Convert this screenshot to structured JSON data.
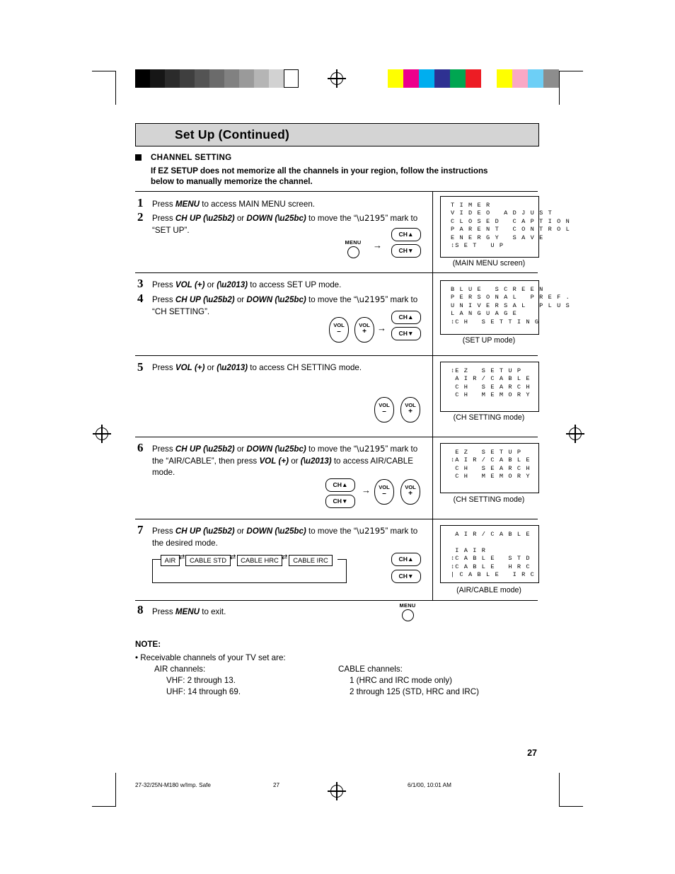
{
  "header": {
    "title": "Set Up (Continued)"
  },
  "intro": {
    "heading": "CHANNEL SETTING",
    "line1": "If EZ SETUP does not memorize all the channels in your region, follow the instructions",
    "line2": "below to manually memorize the channel."
  },
  "steps": [
    {
      "num": "1",
      "text": "Press MENU to access MAIN MENU screen."
    },
    {
      "num": "2",
      "text": "Press CH UP (▲) or DOWN (▼) to move the “↕” mark to “SET UP”."
    },
    {
      "num": "3",
      "text": "Press VOL (+) or (–) to access SET UP mode."
    },
    {
      "num": "4",
      "text": "Press CH UP (▲) or DOWN (▼) to move the “↕” mark to “CH SETTING”."
    },
    {
      "num": "5",
      "text": "Press VOL (+) or (–) to access CH SETTING mode."
    },
    {
      "num": "6",
      "text": "Press CH UP (▲) or DOWN (▼) to move the “↕” mark to the “AIR/CABLE”, then press VOL (+) or (–) to access AIR/CABLE mode."
    },
    {
      "num": "7",
      "text": "Press CH UP (▲) or DOWN (▼) to move the “↕” mark to the desired mode."
    },
    {
      "num": "8",
      "text": "Press MENU to exit."
    }
  ],
  "osd": [
    {
      "lines": "T I M E R\nV I D E O   A D J U S T\nC L O S E D   C A P T I O N\nP A R E N T   C O N T R O L\nE N E R G Y   S A V E\n↕S E T   U P",
      "caption": "(MAIN MENU screen)"
    },
    {
      "lines": "B L U E   S C R E E N\nP E R S O N A L   P R E F .\nU N I V E R S A L   P L U S\nL A N G U A G E\n↕C H   S E T T I N G",
      "caption": "(SET UP mode)"
    },
    {
      "lines": "↕E Z   S E T U P\n A I R / C A B L E\n C H   S E A R C H\n C H   M E M O R Y",
      "caption": "(CH SETTING mode)"
    },
    {
      "lines": " E Z   S E T U P\n↕A I R / C A B L E\n C H   S E A R C H\n C H   M E M O R Y",
      "caption": "(CH SETTING mode)"
    },
    {
      "lines": " A I R / C A B L E\n\n I A I R\n↕C A B L E   S T D\n↕C A B L E   H R C\n| C A B L E   I R C",
      "caption": "(AIR/CABLE mode)"
    }
  ],
  "buttons": {
    "ch_up": "CH▲",
    "ch_down": "CH▼",
    "vol_minus_l1": "VOL",
    "vol_minus_l2": "–",
    "vol_plus_l1": "VOL",
    "vol_plus_l2": "+",
    "menu": "MENU",
    "arrow": "→"
  },
  "chain": {
    "items": [
      "AIR",
      "CABLE STD",
      "CABLE HRC",
      "CABLE IRC"
    ],
    "connector": "⇄"
  },
  "note": {
    "title": "NOTE:",
    "bullet": "• Receivable channels of your TV set are:",
    "air_head": "AIR channels:",
    "air_vhf": "VHF: 2 through 13.",
    "air_uhf": "UHF: 14 through 69.",
    "cable_head": "CABLE channels:",
    "cable_1": "1 (HRC and IRC mode only)",
    "cable_2": "2 through 125 (STD, HRC and IRC)"
  },
  "page_number": "27",
  "footer": {
    "left": "27-32/25N-M180 w/Imp. Safe",
    "center": "27",
    "right": "6/1/00, 10:01 AM"
  },
  "colors": {
    "title_bar_bg": "#d4d4d4",
    "grayscale_bars": [
      "#000000",
      "#1a1a1a",
      "#333333",
      "#4d4d4d",
      "#666666",
      "#808080",
      "#999999",
      "#b3b3b3",
      "#cccccc",
      "#e6e6e6",
      "#ffffff"
    ],
    "color_bars": [
      "#ffff00",
      "#ff00a0",
      "#00aeef",
      "#2e3192",
      "#00a651",
      "#ed1c24",
      "#ffffff",
      "#ffff00",
      "#f7a8c0",
      "#6dcff6",
      "#808080"
    ]
  }
}
